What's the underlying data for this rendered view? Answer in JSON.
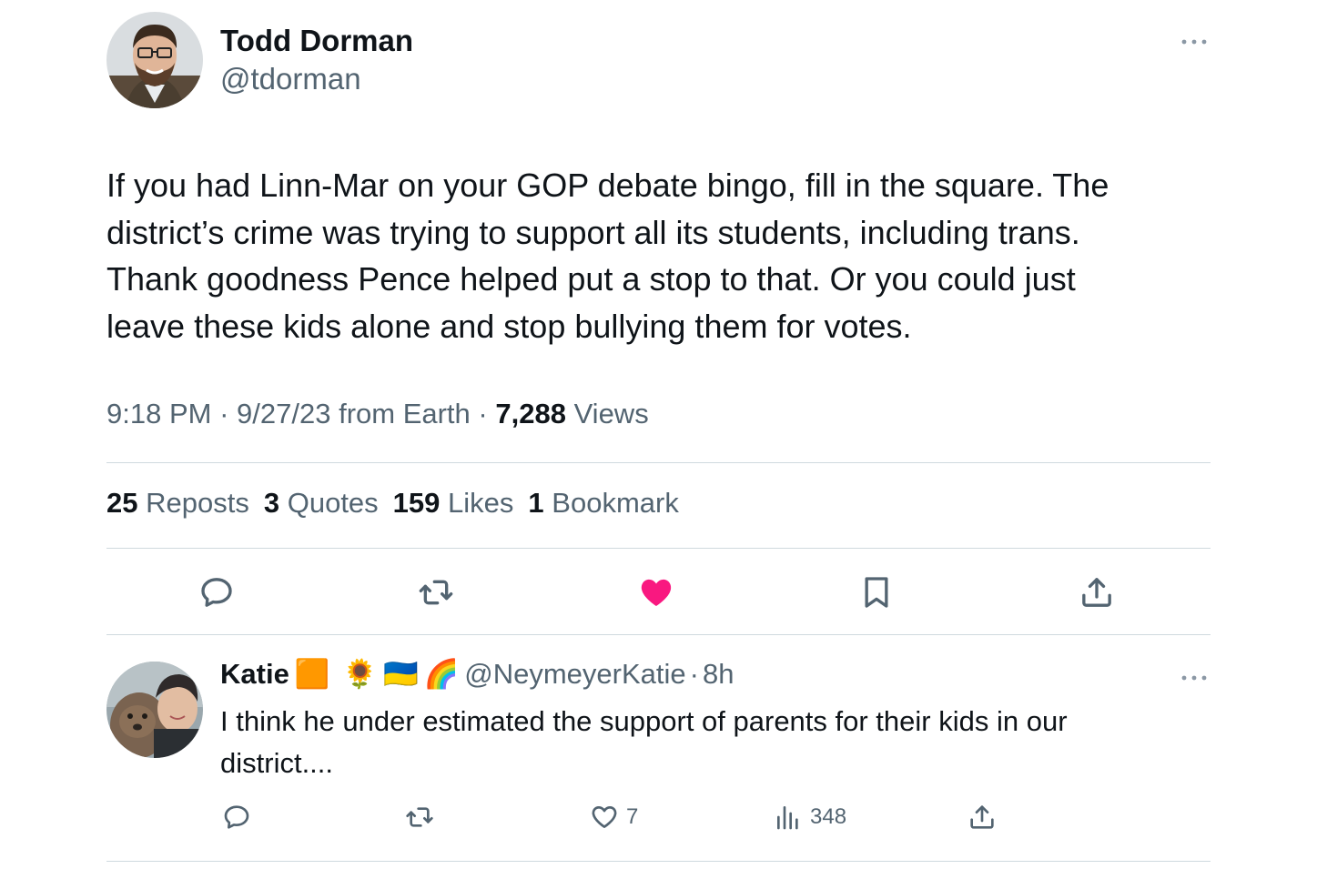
{
  "tweet": {
    "author_name": "Todd Dorman",
    "author_handle": "@tdorman",
    "text_lines": [
      "If you had Linn-Mar on your GOP debate bingo, fill in the square. The",
      "district’s crime was trying to support all its students, including trans.",
      "Thank goodness Pence helped put a stop to that. Or you could just",
      "leave these kids alone and stop bullying them for votes."
    ],
    "time": "9:18 PM",
    "date": "9/27/23",
    "source": "from Earth",
    "views_count": "7,288",
    "views_label": "Views",
    "stats": [
      {
        "count": "25",
        "label": "Reposts"
      },
      {
        "count": "3",
        "label": "Quotes"
      },
      {
        "count": "159",
        "label": "Likes"
      },
      {
        "count": "1",
        "label": "Bookmark"
      }
    ],
    "liked": true,
    "like_color": "#f91880"
  },
  "reply": {
    "author_name": "Katie",
    "emojis": [
      "🟧",
      "🌻",
      "🇺🇦",
      "🌈"
    ],
    "author_handle": "@NeymeyerKatie",
    "separator": "·",
    "age": "8h",
    "text_lines": [
      "I think he under estimated the support of parents for their kids in our",
      "district...."
    ],
    "like_count": "7",
    "views_count": "348"
  },
  "icons": {
    "more": "more-horizontal-icon",
    "reply": "reply-bubble-icon",
    "repost": "repost-icon",
    "like": "heart-icon",
    "bookmark": "bookmark-icon",
    "share": "share-icon",
    "views": "views-bar-chart-icon"
  },
  "colors": {
    "text_primary": "#0f1419",
    "text_secondary": "#536471",
    "divider": "#cfd9de",
    "like": "#f91880"
  }
}
